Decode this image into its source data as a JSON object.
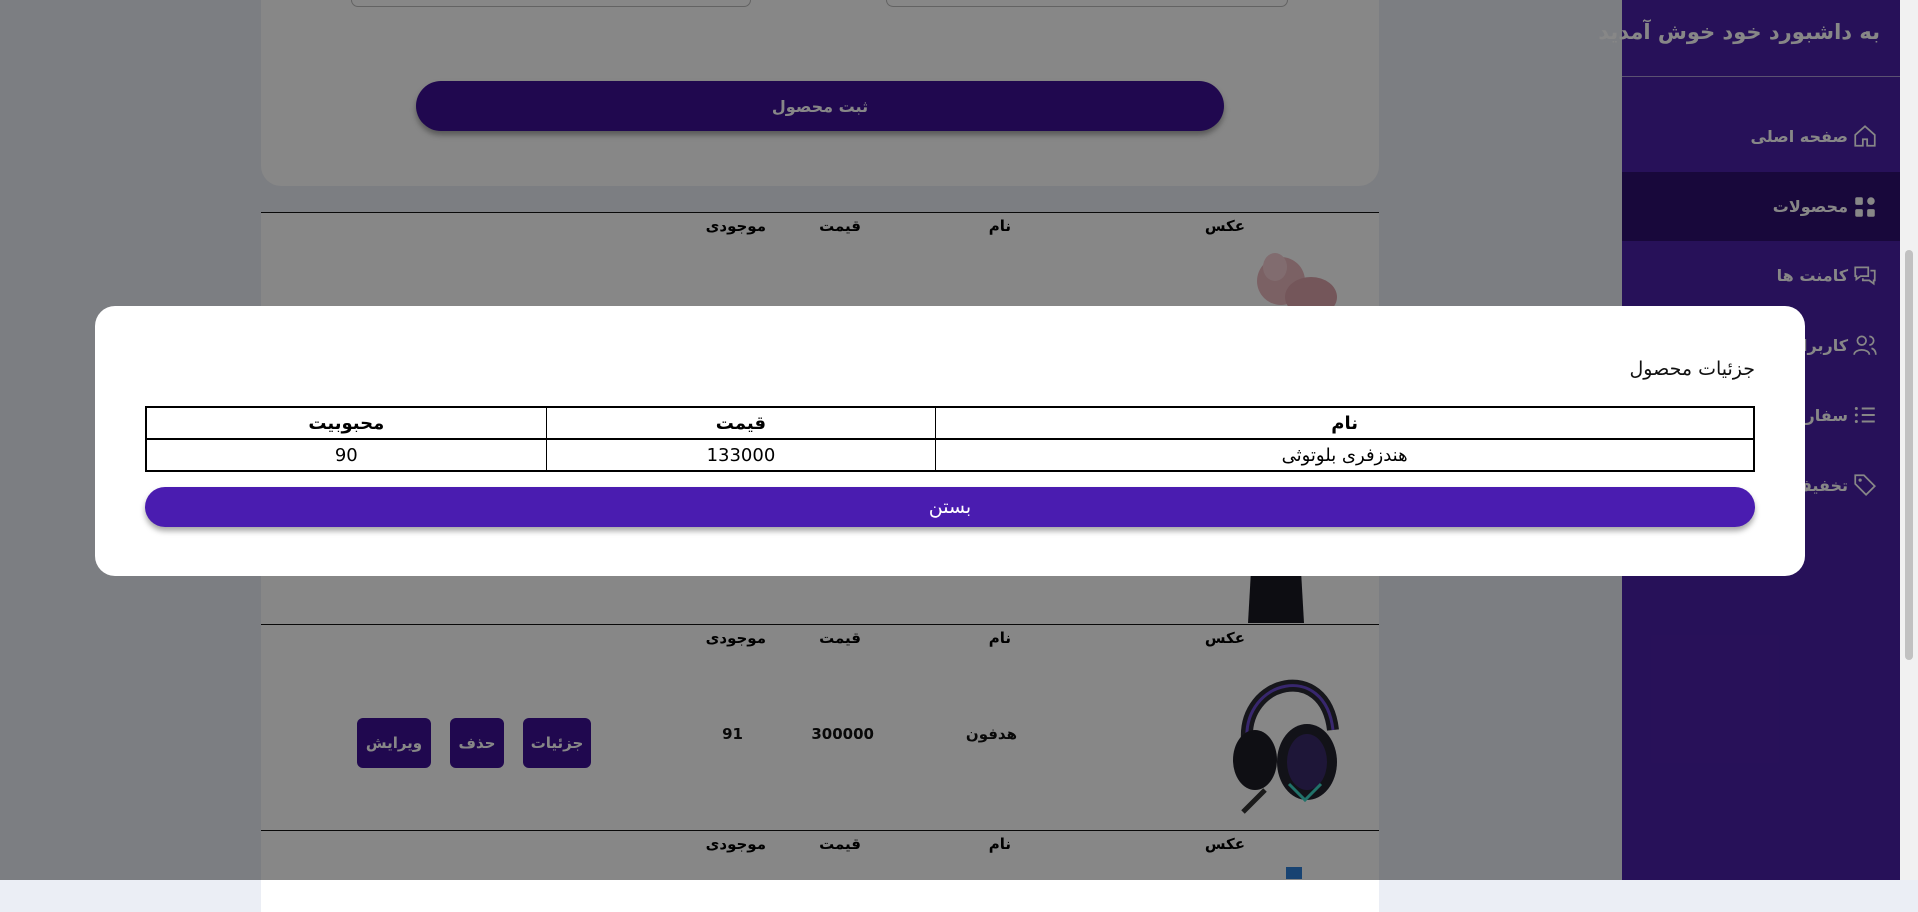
{
  "sidebar": {
    "title": "به داشبورد خود خوش آمدید",
    "items": [
      {
        "label": "صفحه اصلی",
        "icon": "home-icon"
      },
      {
        "label": "محصولات",
        "icon": "grid-icon"
      },
      {
        "label": "کامنت ها",
        "icon": "comments-icon"
      },
      {
        "label": "کاربران",
        "icon": "users-icon"
      },
      {
        "label": "سفارشات",
        "icon": "list-icon"
      },
      {
        "label": "تخفیف ها",
        "icon": "tag-icon"
      }
    ]
  },
  "form": {
    "submit_label": "ثبت محصول"
  },
  "table": {
    "headers": {
      "image": "عکس",
      "name": "نام",
      "price": "قیمت",
      "stock": "موجودی"
    },
    "rows": [
      {
        "name": "هدفون",
        "price": "300000",
        "stock": "91",
        "image": "headphones-image"
      }
    ],
    "actions": {
      "details": "جزئیات",
      "delete": "حذف",
      "edit": "ویرایش"
    }
  },
  "modal": {
    "title": "جزئیات محصول",
    "headers": {
      "name": "نام",
      "price": "قیمت",
      "popularity": "محبوبیت"
    },
    "row": {
      "name": "هندزفری بلوتوثی",
      "price": "133000",
      "popularity": "90"
    },
    "close_label": "بستن"
  },
  "colors": {
    "primary": "#4b20a8",
    "button": "#3d1096",
    "modal_button": "#4a1cb0",
    "active_item": "#2f1070"
  }
}
